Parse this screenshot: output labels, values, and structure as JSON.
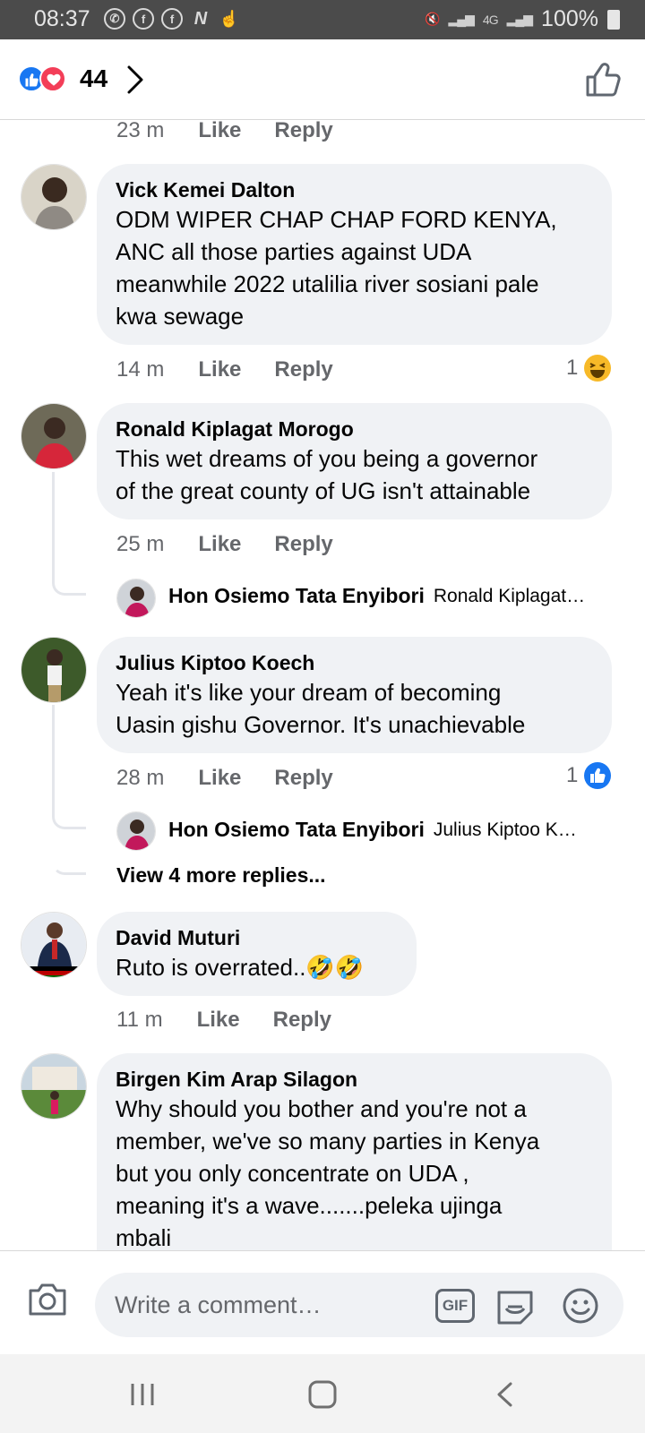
{
  "status_bar": {
    "time": "08:37",
    "battery": "100%",
    "network": "4G"
  },
  "header": {
    "reaction_count": "44",
    "icons": [
      "like-reaction-icon",
      "love-reaction-icon",
      "chevron-right-icon",
      "like-outline-icon"
    ]
  },
  "comments": [
    {
      "meta": {
        "time": "23 m",
        "like": "Like",
        "reply": "Reply"
      }
    },
    {
      "author": "Vick Kemei Dalton",
      "lines": [
        "ODM WIPER CHAP CHAP FORD KENYA,",
        "ANC all those parties against UDA",
        "meanwhile 2022 utalilia river sosiani pale",
        "kwa sewage"
      ],
      "meta": {
        "time": "14 m",
        "like": "Like",
        "reply": "Reply"
      },
      "reaction": {
        "count": "1",
        "icon": "haha-emoji-icon"
      }
    },
    {
      "author": "Ronald Kiplagat Morogo",
      "lines": [
        "This wet dreams of you being a governor",
        "of the great county of UG isn't attainable"
      ],
      "meta": {
        "time": "25 m",
        "like": "Like",
        "reply": "Reply"
      },
      "reply_preview": {
        "author": "Hon Osiemo Tata Enyibori",
        "snippet": "Ronald Kiplagat…"
      }
    },
    {
      "author": "Julius Kiptoo Koech",
      "lines": [
        "Yeah it's like your dream of becoming",
        "Uasin gishu Governor. It's unachievable"
      ],
      "meta": {
        "time": "28 m",
        "like": "Like",
        "reply": "Reply"
      },
      "reaction": {
        "count": "1",
        "icon": "like-reaction-icon"
      },
      "reply_preview": {
        "author": "Hon Osiemo Tata Enyibori",
        "snippet": "Julius Kiptoo K…"
      },
      "view_more": "View 4 more replies..."
    },
    {
      "author": "David Muturi",
      "text": "Ruto is overrated..🤣🤣",
      "meta": {
        "time": "11 m",
        "like": "Like",
        "reply": "Reply"
      }
    },
    {
      "author": "Birgen Kim Arap Silagon",
      "lines": [
        "Why should you bother and you're not a",
        "member, we've so many parties in Kenya",
        "but you only concentrate on UDA ,",
        "meaning it's a wave.......peleka ujinga",
        "mbali"
      ]
    }
  ],
  "composer": {
    "placeholder": "Write a comment…",
    "gif_label": "GIF"
  },
  "colors": {
    "status_bar": "#4b4b4b",
    "bubble": "#f0f2f5",
    "meta_text": "#65676b",
    "like_blue": "#1877f2",
    "love_red": "#f33e58",
    "nav_bar": "#f3f3f3"
  }
}
